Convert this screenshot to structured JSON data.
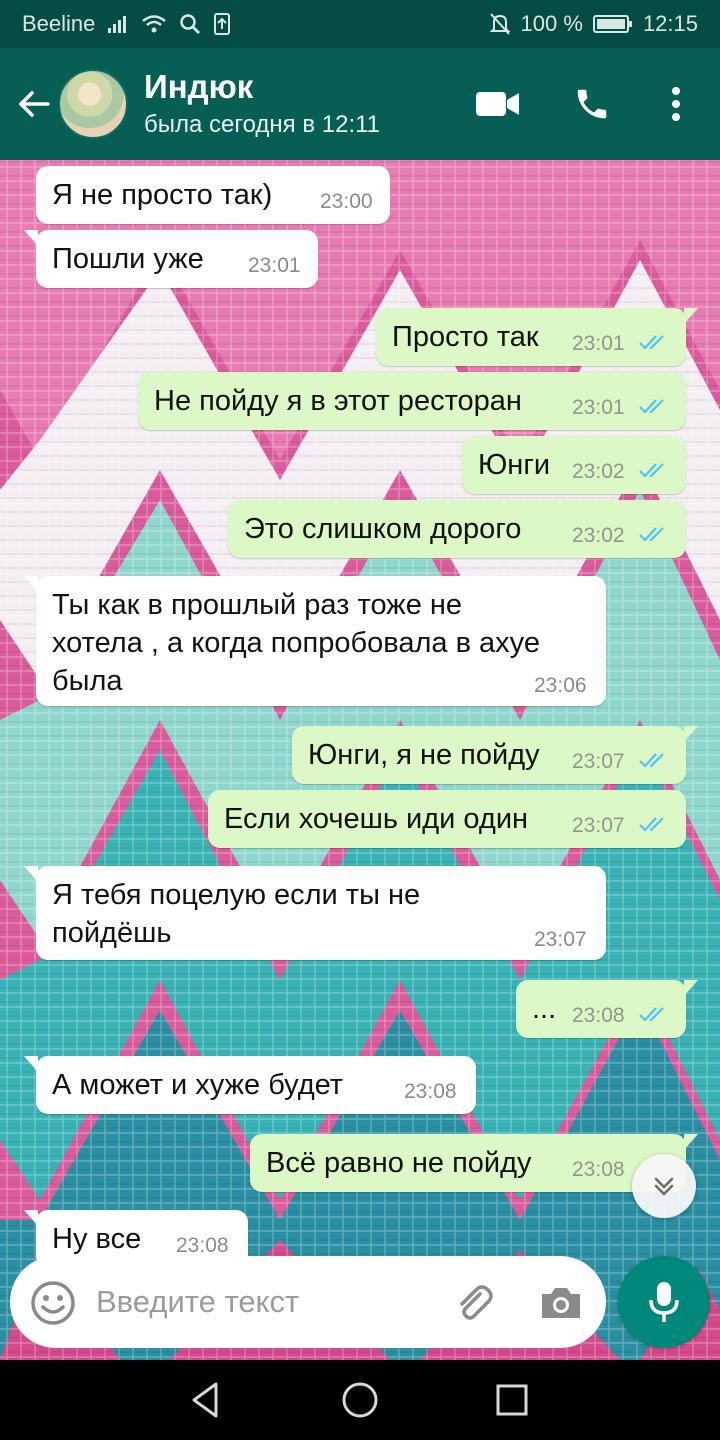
{
  "status_bar": {
    "carrier": "Beeline",
    "battery": "100 %",
    "time": "12:15"
  },
  "header": {
    "contact_name": "Индюк",
    "last_seen": "была сегодня в 12:11",
    "icons": [
      "back-arrow-icon",
      "video-call-icon",
      "phone-icon",
      "more-icon"
    ]
  },
  "messages": [
    {
      "dir": "in",
      "text": "Я не просто так)",
      "time": "23:00"
    },
    {
      "dir": "in",
      "text": "Пошли уже",
      "time": "23:01"
    },
    {
      "dir": "out",
      "text": "Просто так",
      "time": "23:01"
    },
    {
      "dir": "out",
      "text": "Не пойду я в этот ресторан",
      "time": "23:01"
    },
    {
      "dir": "out",
      "text": "Юнги",
      "time": "23:02"
    },
    {
      "dir": "out",
      "text": "Это слишком дорого",
      "time": "23:02"
    },
    {
      "dir": "in",
      "text": "Ты как в прошлый раз тоже не\nхотела , а когда попробовала в ахуе\nбыла",
      "time": "23:06"
    },
    {
      "dir": "out",
      "text": "Юнги, я не пойду",
      "time": "23:07"
    },
    {
      "dir": "out",
      "text": "Если хочешь иди один",
      "time": "23:07"
    },
    {
      "dir": "in",
      "text": "Я тебя поцелую если ты не\nпойдёшь",
      "time": "23:07"
    },
    {
      "dir": "out",
      "text": "...",
      "time": "23:08"
    },
    {
      "dir": "in",
      "text": "А может и хуже будет",
      "time": "23:08"
    },
    {
      "dir": "out",
      "text": "Всё равно не пойду",
      "time": "23:08"
    },
    {
      "dir": "in",
      "text": "Ну все",
      "time": "23:08"
    }
  ],
  "input": {
    "placeholder": "Введите текст"
  },
  "colors": {
    "header": "#075e54",
    "status_bar": "#054d44",
    "outgoing_bubble": "#dcf8c6",
    "incoming_bubble": "#ffffff",
    "read_ticks": "#4fc3f7",
    "mic_button": "#00897b"
  }
}
